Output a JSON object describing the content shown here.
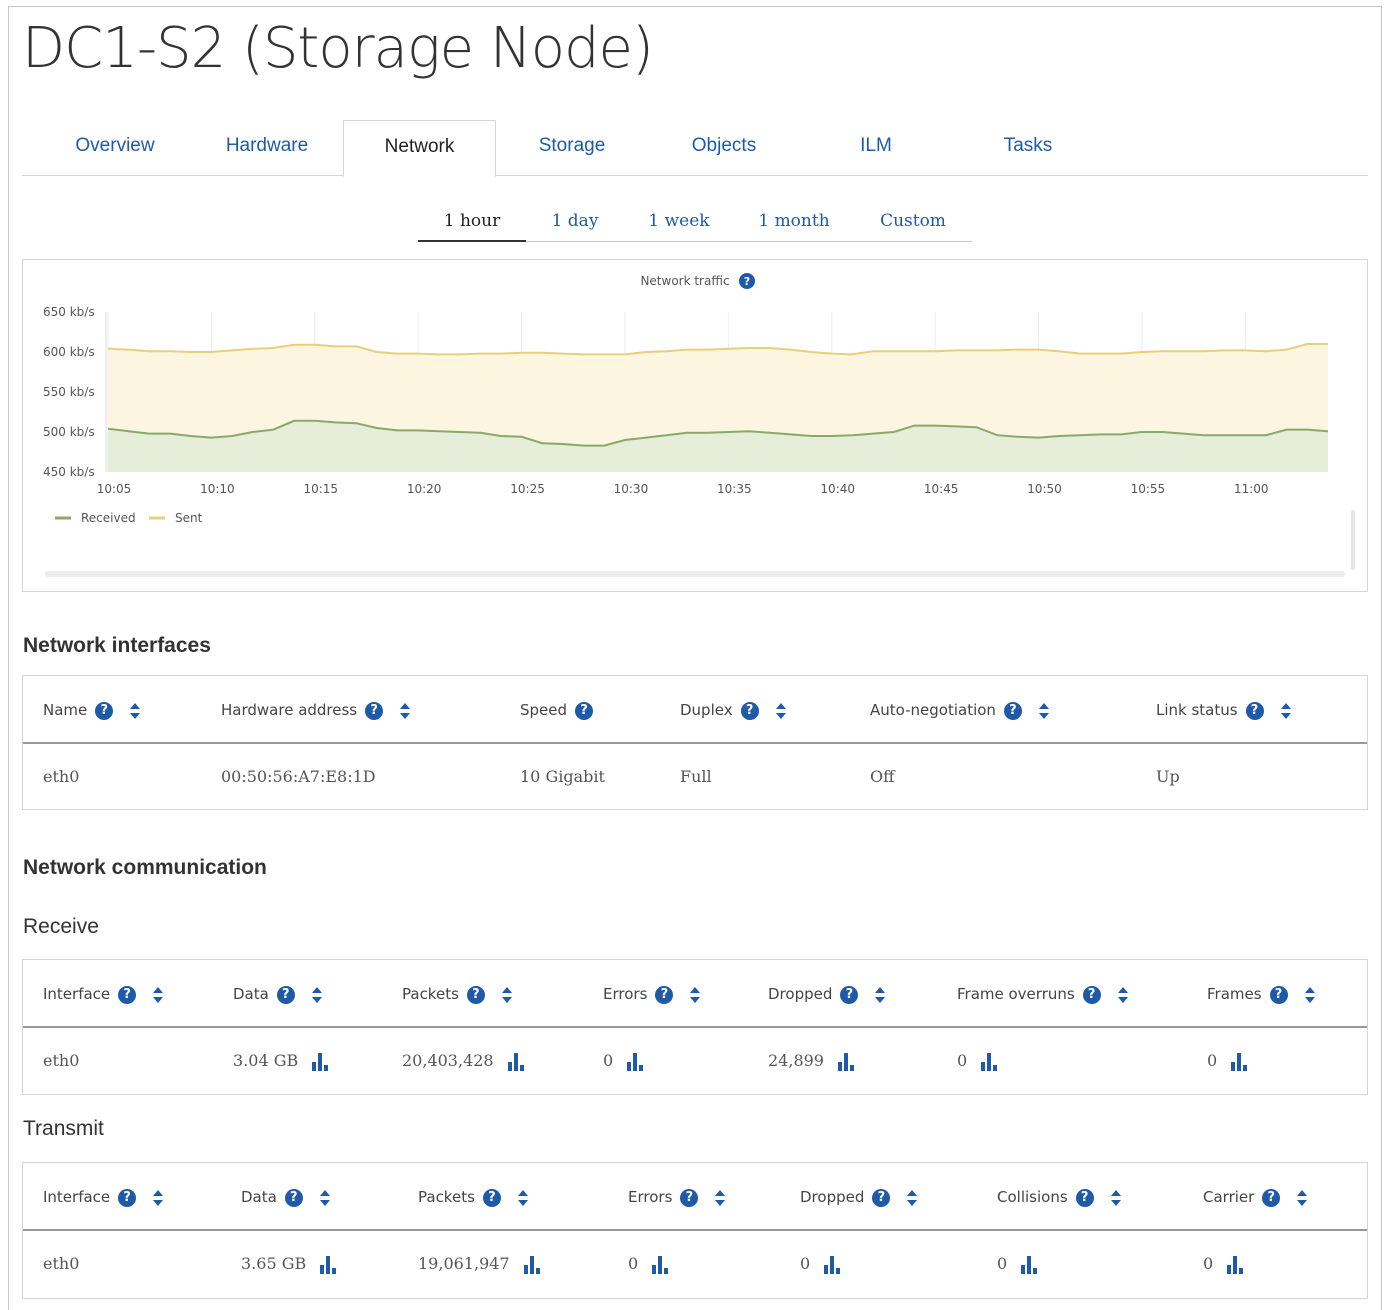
{
  "page_title": "DC1-S2 (Storage Node)",
  "tabs": [
    {
      "label": "Overview",
      "active": false
    },
    {
      "label": "Hardware",
      "active": false
    },
    {
      "label": "Network",
      "active": true
    },
    {
      "label": "Storage",
      "active": false
    },
    {
      "label": "Objects",
      "active": false
    },
    {
      "label": "ILM",
      "active": false
    },
    {
      "label": "Tasks",
      "active": false
    }
  ],
  "periods": [
    {
      "label": "1 hour",
      "active": true
    },
    {
      "label": "1 day",
      "active": false
    },
    {
      "label": "1 week",
      "active": false
    },
    {
      "label": "1 month",
      "active": false
    },
    {
      "label": "Custom",
      "active": false
    }
  ],
  "colors": {
    "accent": "#1e5aa8",
    "received": "#8aa86a",
    "sent": "#e8cf7a",
    "received_fill": "#e6edd8",
    "sent_fill": "#fcf6e0"
  },
  "chart_data": {
    "type": "area",
    "title": "Network traffic",
    "ylabel_unit": "kb/s",
    "ylim": [
      450,
      650
    ],
    "y_ticks": [
      "650 kb/s",
      "600 kb/s",
      "550 kb/s",
      "500 kb/s",
      "450 kb/s"
    ],
    "y_tick_values": [
      650,
      600,
      550,
      500,
      450
    ],
    "x_ticks": [
      "10:05",
      "10:10",
      "10:15",
      "10:20",
      "10:25",
      "10:30",
      "10:35",
      "10:40",
      "10:45",
      "10:50",
      "10:55",
      "11:00"
    ],
    "x_tick_minutes": [
      5,
      10,
      15,
      20,
      25,
      30,
      35,
      40,
      45,
      50,
      55,
      60
    ],
    "x_range_minutes": [
      5,
      64
    ],
    "legend": "bottom-left",
    "grid": true,
    "series": [
      {
        "name": "Sent",
        "x_minutes": [
          5,
          6,
          7,
          8,
          9,
          10,
          11,
          12,
          13,
          14,
          15,
          16,
          17,
          18,
          19,
          20,
          21,
          22,
          23,
          24,
          25,
          26,
          27,
          28,
          29,
          30,
          31,
          32,
          33,
          34,
          35,
          36,
          37,
          38,
          39,
          40,
          41,
          42,
          43,
          44,
          45,
          46,
          47,
          48,
          49,
          50,
          51,
          52,
          53,
          54,
          55,
          56,
          57,
          58,
          59,
          60,
          61,
          62,
          63,
          64
        ],
        "values": [
          604,
          603,
          601,
          601,
          600,
          600,
          602,
          604,
          605,
          609,
          609,
          607,
          607,
          600,
          598,
          598,
          597,
          597,
          598,
          598,
          599,
          599,
          598,
          597,
          597,
          597,
          600,
          601,
          603,
          603,
          604,
          605,
          605,
          603,
          600,
          598,
          597,
          601,
          601,
          601,
          601,
          602,
          602,
          602,
          603,
          603,
          601,
          598,
          598,
          598,
          600,
          601,
          601,
          601,
          602,
          602,
          601,
          603,
          610,
          610
        ]
      },
      {
        "name": "Received",
        "x_minutes": [
          5,
          6,
          7,
          8,
          9,
          10,
          11,
          12,
          13,
          14,
          15,
          16,
          17,
          18,
          19,
          20,
          21,
          22,
          23,
          24,
          25,
          26,
          27,
          28,
          29,
          30,
          31,
          32,
          33,
          34,
          35,
          36,
          37,
          38,
          39,
          40,
          41,
          42,
          43,
          44,
          45,
          46,
          47,
          48,
          49,
          50,
          51,
          52,
          53,
          54,
          55,
          56,
          57,
          58,
          59,
          60,
          61,
          62,
          63,
          64
        ],
        "values": [
          504,
          501,
          498,
          498,
          495,
          493,
          495,
          500,
          503,
          514,
          514,
          512,
          511,
          505,
          502,
          502,
          501,
          500,
          499,
          495,
          494,
          486,
          485,
          483,
          483,
          490,
          493,
          496,
          499,
          499,
          500,
          501,
          499,
          497,
          495,
          495,
          496,
          498,
          500,
          508,
          508,
          507,
          506,
          496,
          494,
          493,
          495,
          496,
          497,
          497,
          500,
          500,
          498,
          496,
          496,
          496,
          496,
          503,
          503,
          501
        ]
      }
    ]
  },
  "network_interfaces": {
    "title": "Network interfaces",
    "headers": [
      {
        "label": "Name",
        "help": true,
        "sort": true
      },
      {
        "label": "Hardware address",
        "help": true,
        "sort": true
      },
      {
        "label": "Speed",
        "help": true,
        "sort": false
      },
      {
        "label": "Duplex",
        "help": true,
        "sort": true
      },
      {
        "label": "Auto-negotiation",
        "help": true,
        "sort": true
      },
      {
        "label": "Link status",
        "help": true,
        "sort": true
      }
    ],
    "rows": [
      [
        "eth0",
        "00:50:56:A7:E8:1D",
        "10 Gigabit",
        "Full",
        "Off",
        "Up"
      ]
    ]
  },
  "network_communication": {
    "title": "Network communication",
    "receive": {
      "title": "Receive",
      "headers": [
        "Interface",
        "Data",
        "Packets",
        "Errors",
        "Dropped",
        "Frame overruns",
        "Frames"
      ],
      "rows": [
        [
          "eth0",
          "3.04 GB",
          "20,403,428",
          "0",
          "24,899",
          "0",
          "0"
        ]
      ]
    },
    "transmit": {
      "title": "Transmit",
      "headers": [
        "Interface",
        "Data",
        "Packets",
        "Errors",
        "Dropped",
        "Collisions",
        "Carrier"
      ],
      "rows": [
        [
          "eth0",
          "3.65 GB",
          "19,061,947",
          "0",
          "0",
          "0",
          "0"
        ]
      ]
    }
  },
  "icons": {
    "help": "question-circle-icon",
    "sort": "sort-icon",
    "chart": "bar-chart-icon"
  },
  "help_glyph": "?"
}
